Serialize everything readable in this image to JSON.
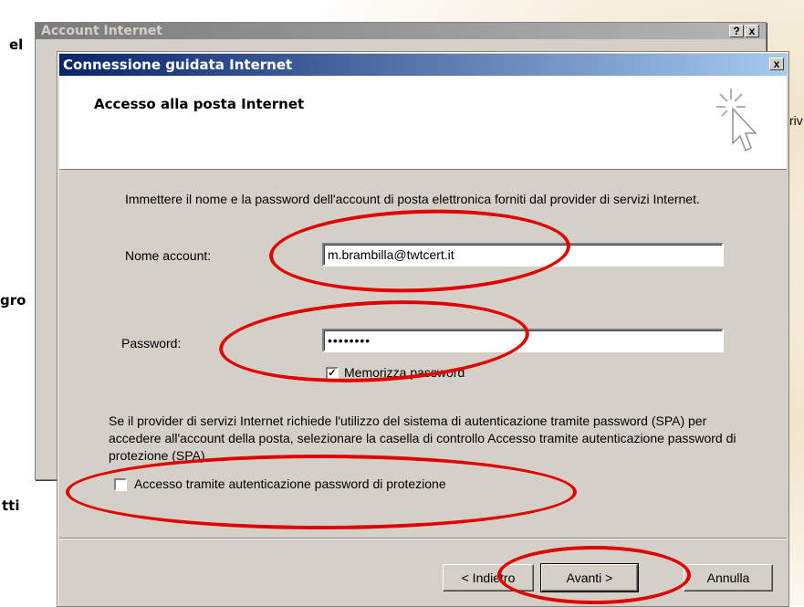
{
  "background": {
    "side_fragments": [
      "el",
      "gro",
      "tti"
    ],
    "right_fragment": "riv"
  },
  "back_window": {
    "title": "Account Internet",
    "help_glyph": "?",
    "close_glyph": "x"
  },
  "dialog": {
    "title": "Connessione guidata Internet",
    "close_glyph": "x",
    "header_title": "Accesso alla posta Internet",
    "wizard_icon": "cursor-sparkle-icon",
    "intro_text": "Immettere il nome e la password dell'account di posta elettronica forniti dal provider di servizi Internet.",
    "account": {
      "label": "Nome account:",
      "value": "m.brambilla@twtcert.it"
    },
    "password": {
      "label": "Password:",
      "value": "••••••••"
    },
    "remember": {
      "label": "Memorizza password",
      "checked": true,
      "check_glyph": "✓"
    },
    "spa_text": "Se il provider di servizi Internet richiede l'utilizzo del sistema di autenticazione tramite password (SPA) per accedere all'account della posta, selezionare la casella di controllo Accesso tramite autenticazione password di protezione (SPA).",
    "spa_checkbox": {
      "label": "Accesso tramite autenticazione password di protezione",
      "checked": false
    },
    "buttons": {
      "back": "< Indietro",
      "next": "Avanti >",
      "cancel": "Annulla"
    }
  },
  "colors": {
    "annotation": "#e00000",
    "title_active": "#0a246a",
    "dialog_face": "#d4d0c8"
  }
}
